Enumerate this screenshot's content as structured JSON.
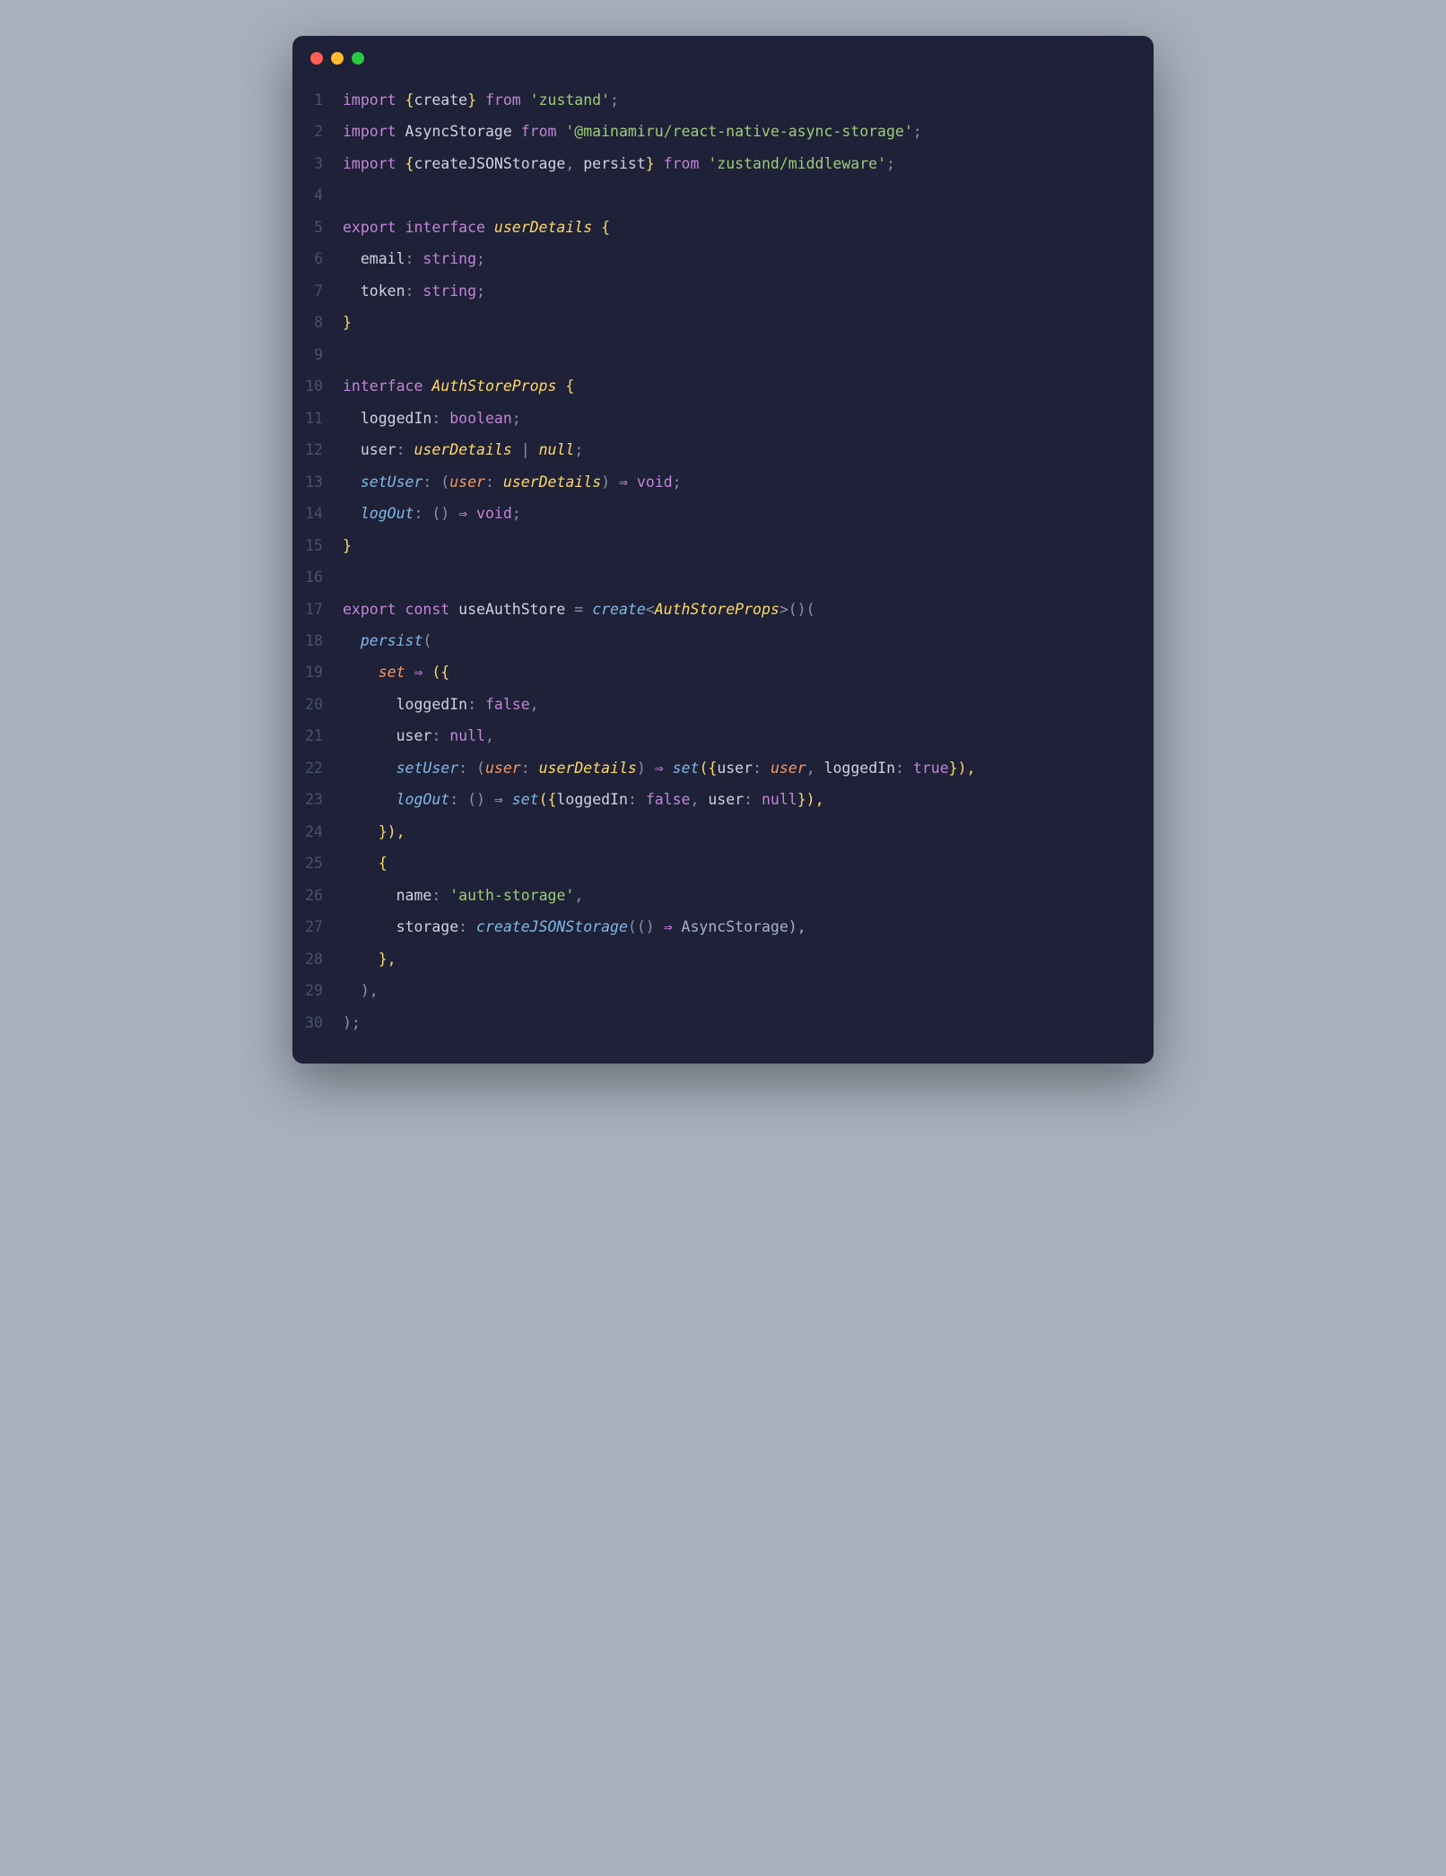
{
  "window": {
    "dots": [
      "red",
      "yellow",
      "green"
    ]
  },
  "code": {
    "lines": [
      {
        "num": "1",
        "tokens": [
          {
            "t": "import ",
            "c": "tok-keyword"
          },
          {
            "t": "{",
            "c": "tok-brace"
          },
          {
            "t": "create",
            "c": "tok-identifier"
          },
          {
            "t": "}",
            "c": "tok-brace"
          },
          {
            "t": " from ",
            "c": "tok-keyword"
          },
          {
            "t": "'zustand'",
            "c": "tok-string"
          },
          {
            "t": ";",
            "c": "tok-punct"
          }
        ]
      },
      {
        "num": "2",
        "tokens": [
          {
            "t": "import ",
            "c": "tok-keyword"
          },
          {
            "t": "AsyncStorage",
            "c": "tok-identifier"
          },
          {
            "t": " from ",
            "c": "tok-keyword"
          },
          {
            "t": "'@mainamiru/react-native-async-storage'",
            "c": "tok-string"
          },
          {
            "t": ";",
            "c": "tok-punct"
          }
        ]
      },
      {
        "num": "3",
        "tokens": [
          {
            "t": "import ",
            "c": "tok-keyword"
          },
          {
            "t": "{",
            "c": "tok-brace"
          },
          {
            "t": "createJSONStorage",
            "c": "tok-identifier"
          },
          {
            "t": ", ",
            "c": "tok-punct"
          },
          {
            "t": "persist",
            "c": "tok-identifier"
          },
          {
            "t": "}",
            "c": "tok-brace"
          },
          {
            "t": " from ",
            "c": "tok-keyword"
          },
          {
            "t": "'zustand/middleware'",
            "c": "tok-string"
          },
          {
            "t": ";",
            "c": "tok-punct"
          }
        ]
      },
      {
        "num": "4",
        "tokens": []
      },
      {
        "num": "5",
        "tokens": [
          {
            "t": "export ",
            "c": "tok-keyword"
          },
          {
            "t": "interface ",
            "c": "tok-keyword"
          },
          {
            "t": "userDetails",
            "c": "tok-typename"
          },
          {
            "t": " {",
            "c": "tok-brace"
          }
        ]
      },
      {
        "num": "6",
        "tokens": [
          {
            "t": "  ",
            "c": "tok-default"
          },
          {
            "t": "email",
            "c": "tok-prop"
          },
          {
            "t": ": ",
            "c": "tok-punct"
          },
          {
            "t": "string",
            "c": "tok-type"
          },
          {
            "t": ";",
            "c": "tok-punct"
          }
        ]
      },
      {
        "num": "7",
        "tokens": [
          {
            "t": "  ",
            "c": "tok-default"
          },
          {
            "t": "token",
            "c": "tok-prop"
          },
          {
            "t": ": ",
            "c": "tok-punct"
          },
          {
            "t": "string",
            "c": "tok-type"
          },
          {
            "t": ";",
            "c": "tok-punct"
          }
        ]
      },
      {
        "num": "8",
        "tokens": [
          {
            "t": "}",
            "c": "tok-brace"
          }
        ]
      },
      {
        "num": "9",
        "tokens": []
      },
      {
        "num": "10",
        "tokens": [
          {
            "t": "interface ",
            "c": "tok-keyword"
          },
          {
            "t": "AuthStoreProps",
            "c": "tok-typename"
          },
          {
            "t": " {",
            "c": "tok-brace"
          }
        ]
      },
      {
        "num": "11",
        "tokens": [
          {
            "t": "  ",
            "c": "tok-default"
          },
          {
            "t": "loggedIn",
            "c": "tok-prop"
          },
          {
            "t": ": ",
            "c": "tok-punct"
          },
          {
            "t": "boolean",
            "c": "tok-type"
          },
          {
            "t": ";",
            "c": "tok-punct"
          }
        ]
      },
      {
        "num": "12",
        "tokens": [
          {
            "t": "  ",
            "c": "tok-default"
          },
          {
            "t": "user",
            "c": "tok-prop"
          },
          {
            "t": ": ",
            "c": "tok-punct"
          },
          {
            "t": "userDetails",
            "c": "tok-typename"
          },
          {
            "t": " | ",
            "c": "tok-punct"
          },
          {
            "t": "null",
            "c": "tok-typename"
          },
          {
            "t": ";",
            "c": "tok-punct"
          }
        ]
      },
      {
        "num": "13",
        "tokens": [
          {
            "t": "  ",
            "c": "tok-default"
          },
          {
            "t": "setUser",
            "c": "tok-func"
          },
          {
            "t": ": (",
            "c": "tok-punct"
          },
          {
            "t": "user",
            "c": "tok-param"
          },
          {
            "t": ": ",
            "c": "tok-punct"
          },
          {
            "t": "userDetails",
            "c": "tok-typename"
          },
          {
            "t": ") ",
            "c": "tok-punct"
          },
          {
            "t": "⇒",
            "c": "tok-arrow"
          },
          {
            "t": " ",
            "c": "tok-default"
          },
          {
            "t": "void",
            "c": "tok-void"
          },
          {
            "t": ";",
            "c": "tok-punct"
          }
        ]
      },
      {
        "num": "14",
        "tokens": [
          {
            "t": "  ",
            "c": "tok-default"
          },
          {
            "t": "logOut",
            "c": "tok-func"
          },
          {
            "t": ": () ",
            "c": "tok-punct"
          },
          {
            "t": "⇒",
            "c": "tok-arrow"
          },
          {
            "t": " ",
            "c": "tok-default"
          },
          {
            "t": "void",
            "c": "tok-void"
          },
          {
            "t": ";",
            "c": "tok-punct"
          }
        ]
      },
      {
        "num": "15",
        "tokens": [
          {
            "t": "}",
            "c": "tok-brace"
          }
        ]
      },
      {
        "num": "16",
        "tokens": []
      },
      {
        "num": "17",
        "tokens": [
          {
            "t": "export ",
            "c": "tok-keyword"
          },
          {
            "t": "const ",
            "c": "tok-const"
          },
          {
            "t": "useAuthStore",
            "c": "tok-constname"
          },
          {
            "t": " = ",
            "c": "tok-punct"
          },
          {
            "t": "create",
            "c": "tok-func"
          },
          {
            "t": "<",
            "c": "tok-punct"
          },
          {
            "t": "AuthStoreProps",
            "c": "tok-typename"
          },
          {
            "t": ">()(",
            "c": "tok-punct"
          }
        ]
      },
      {
        "num": "18",
        "tokens": [
          {
            "t": "  ",
            "c": "tok-default"
          },
          {
            "t": "persist",
            "c": "tok-func"
          },
          {
            "t": "(",
            "c": "tok-punct"
          }
        ]
      },
      {
        "num": "19",
        "tokens": [
          {
            "t": "    ",
            "c": "tok-default"
          },
          {
            "t": "set",
            "c": "tok-param"
          },
          {
            "t": " ",
            "c": "tok-default"
          },
          {
            "t": "⇒",
            "c": "tok-arrow"
          },
          {
            "t": " ({",
            "c": "tok-brace"
          }
        ]
      },
      {
        "num": "20",
        "tokens": [
          {
            "t": "      ",
            "c": "tok-default"
          },
          {
            "t": "loggedIn",
            "c": "tok-prop"
          },
          {
            "t": ": ",
            "c": "tok-punct"
          },
          {
            "t": "false",
            "c": "tok-bool"
          },
          {
            "t": ",",
            "c": "tok-punct"
          }
        ]
      },
      {
        "num": "21",
        "tokens": [
          {
            "t": "      ",
            "c": "tok-default"
          },
          {
            "t": "user",
            "c": "tok-prop"
          },
          {
            "t": ": ",
            "c": "tok-punct"
          },
          {
            "t": "null",
            "c": "tok-null"
          },
          {
            "t": ",",
            "c": "tok-punct"
          }
        ]
      },
      {
        "num": "22",
        "tokens": [
          {
            "t": "      ",
            "c": "tok-default"
          },
          {
            "t": "setUser",
            "c": "tok-func"
          },
          {
            "t": ": (",
            "c": "tok-punct"
          },
          {
            "t": "user",
            "c": "tok-param"
          },
          {
            "t": ": ",
            "c": "tok-punct"
          },
          {
            "t": "userDetails",
            "c": "tok-typename"
          },
          {
            "t": ") ",
            "c": "tok-punct"
          },
          {
            "t": "⇒",
            "c": "tok-arrow"
          },
          {
            "t": " ",
            "c": "tok-default"
          },
          {
            "t": "set",
            "c": "tok-func"
          },
          {
            "t": "({",
            "c": "tok-brace"
          },
          {
            "t": "user",
            "c": "tok-prop"
          },
          {
            "t": ": ",
            "c": "tok-punct"
          },
          {
            "t": "user",
            "c": "tok-param"
          },
          {
            "t": ", ",
            "c": "tok-punct"
          },
          {
            "t": "loggedIn",
            "c": "tok-prop"
          },
          {
            "t": ": ",
            "c": "tok-punct"
          },
          {
            "t": "true",
            "c": "tok-bool"
          },
          {
            "t": "}),",
            "c": "tok-brace"
          }
        ]
      },
      {
        "num": "23",
        "tokens": [
          {
            "t": "      ",
            "c": "tok-default"
          },
          {
            "t": "logOut",
            "c": "tok-func"
          },
          {
            "t": ": () ",
            "c": "tok-punct"
          },
          {
            "t": "⇒",
            "c": "tok-arrow"
          },
          {
            "t": " ",
            "c": "tok-default"
          },
          {
            "t": "set",
            "c": "tok-func"
          },
          {
            "t": "({",
            "c": "tok-brace"
          },
          {
            "t": "loggedIn",
            "c": "tok-prop"
          },
          {
            "t": ": ",
            "c": "tok-punct"
          },
          {
            "t": "false",
            "c": "tok-bool"
          },
          {
            "t": ", ",
            "c": "tok-punct"
          },
          {
            "t": "user",
            "c": "tok-prop"
          },
          {
            "t": ": ",
            "c": "tok-punct"
          },
          {
            "t": "null",
            "c": "tok-null"
          },
          {
            "t": "}),",
            "c": "tok-brace"
          }
        ]
      },
      {
        "num": "24",
        "tokens": [
          {
            "t": "    }),",
            "c": "tok-brace"
          }
        ]
      },
      {
        "num": "25",
        "tokens": [
          {
            "t": "    {",
            "c": "tok-brace"
          }
        ]
      },
      {
        "num": "26",
        "tokens": [
          {
            "t": "      ",
            "c": "tok-default"
          },
          {
            "t": "name",
            "c": "tok-prop"
          },
          {
            "t": ": ",
            "c": "tok-punct"
          },
          {
            "t": "'auth-storage'",
            "c": "tok-string"
          },
          {
            "t": ",",
            "c": "tok-punct"
          }
        ]
      },
      {
        "num": "27",
        "tokens": [
          {
            "t": "      ",
            "c": "tok-default"
          },
          {
            "t": "storage",
            "c": "tok-prop"
          },
          {
            "t": ": ",
            "c": "tok-punct"
          },
          {
            "t": "createJSONStorage",
            "c": "tok-func"
          },
          {
            "t": "(() ",
            "c": "tok-punct"
          },
          {
            "t": "⇒",
            "c": "tok-arrow"
          },
          {
            "t": " AsyncStorage),",
            "c": "tok-default"
          }
        ]
      },
      {
        "num": "28",
        "tokens": [
          {
            "t": "    },",
            "c": "tok-brace"
          }
        ]
      },
      {
        "num": "29",
        "tokens": [
          {
            "t": "  ),",
            "c": "tok-punct"
          }
        ]
      },
      {
        "num": "30",
        "tokens": [
          {
            "t": ");",
            "c": "tok-punct"
          }
        ]
      }
    ]
  }
}
